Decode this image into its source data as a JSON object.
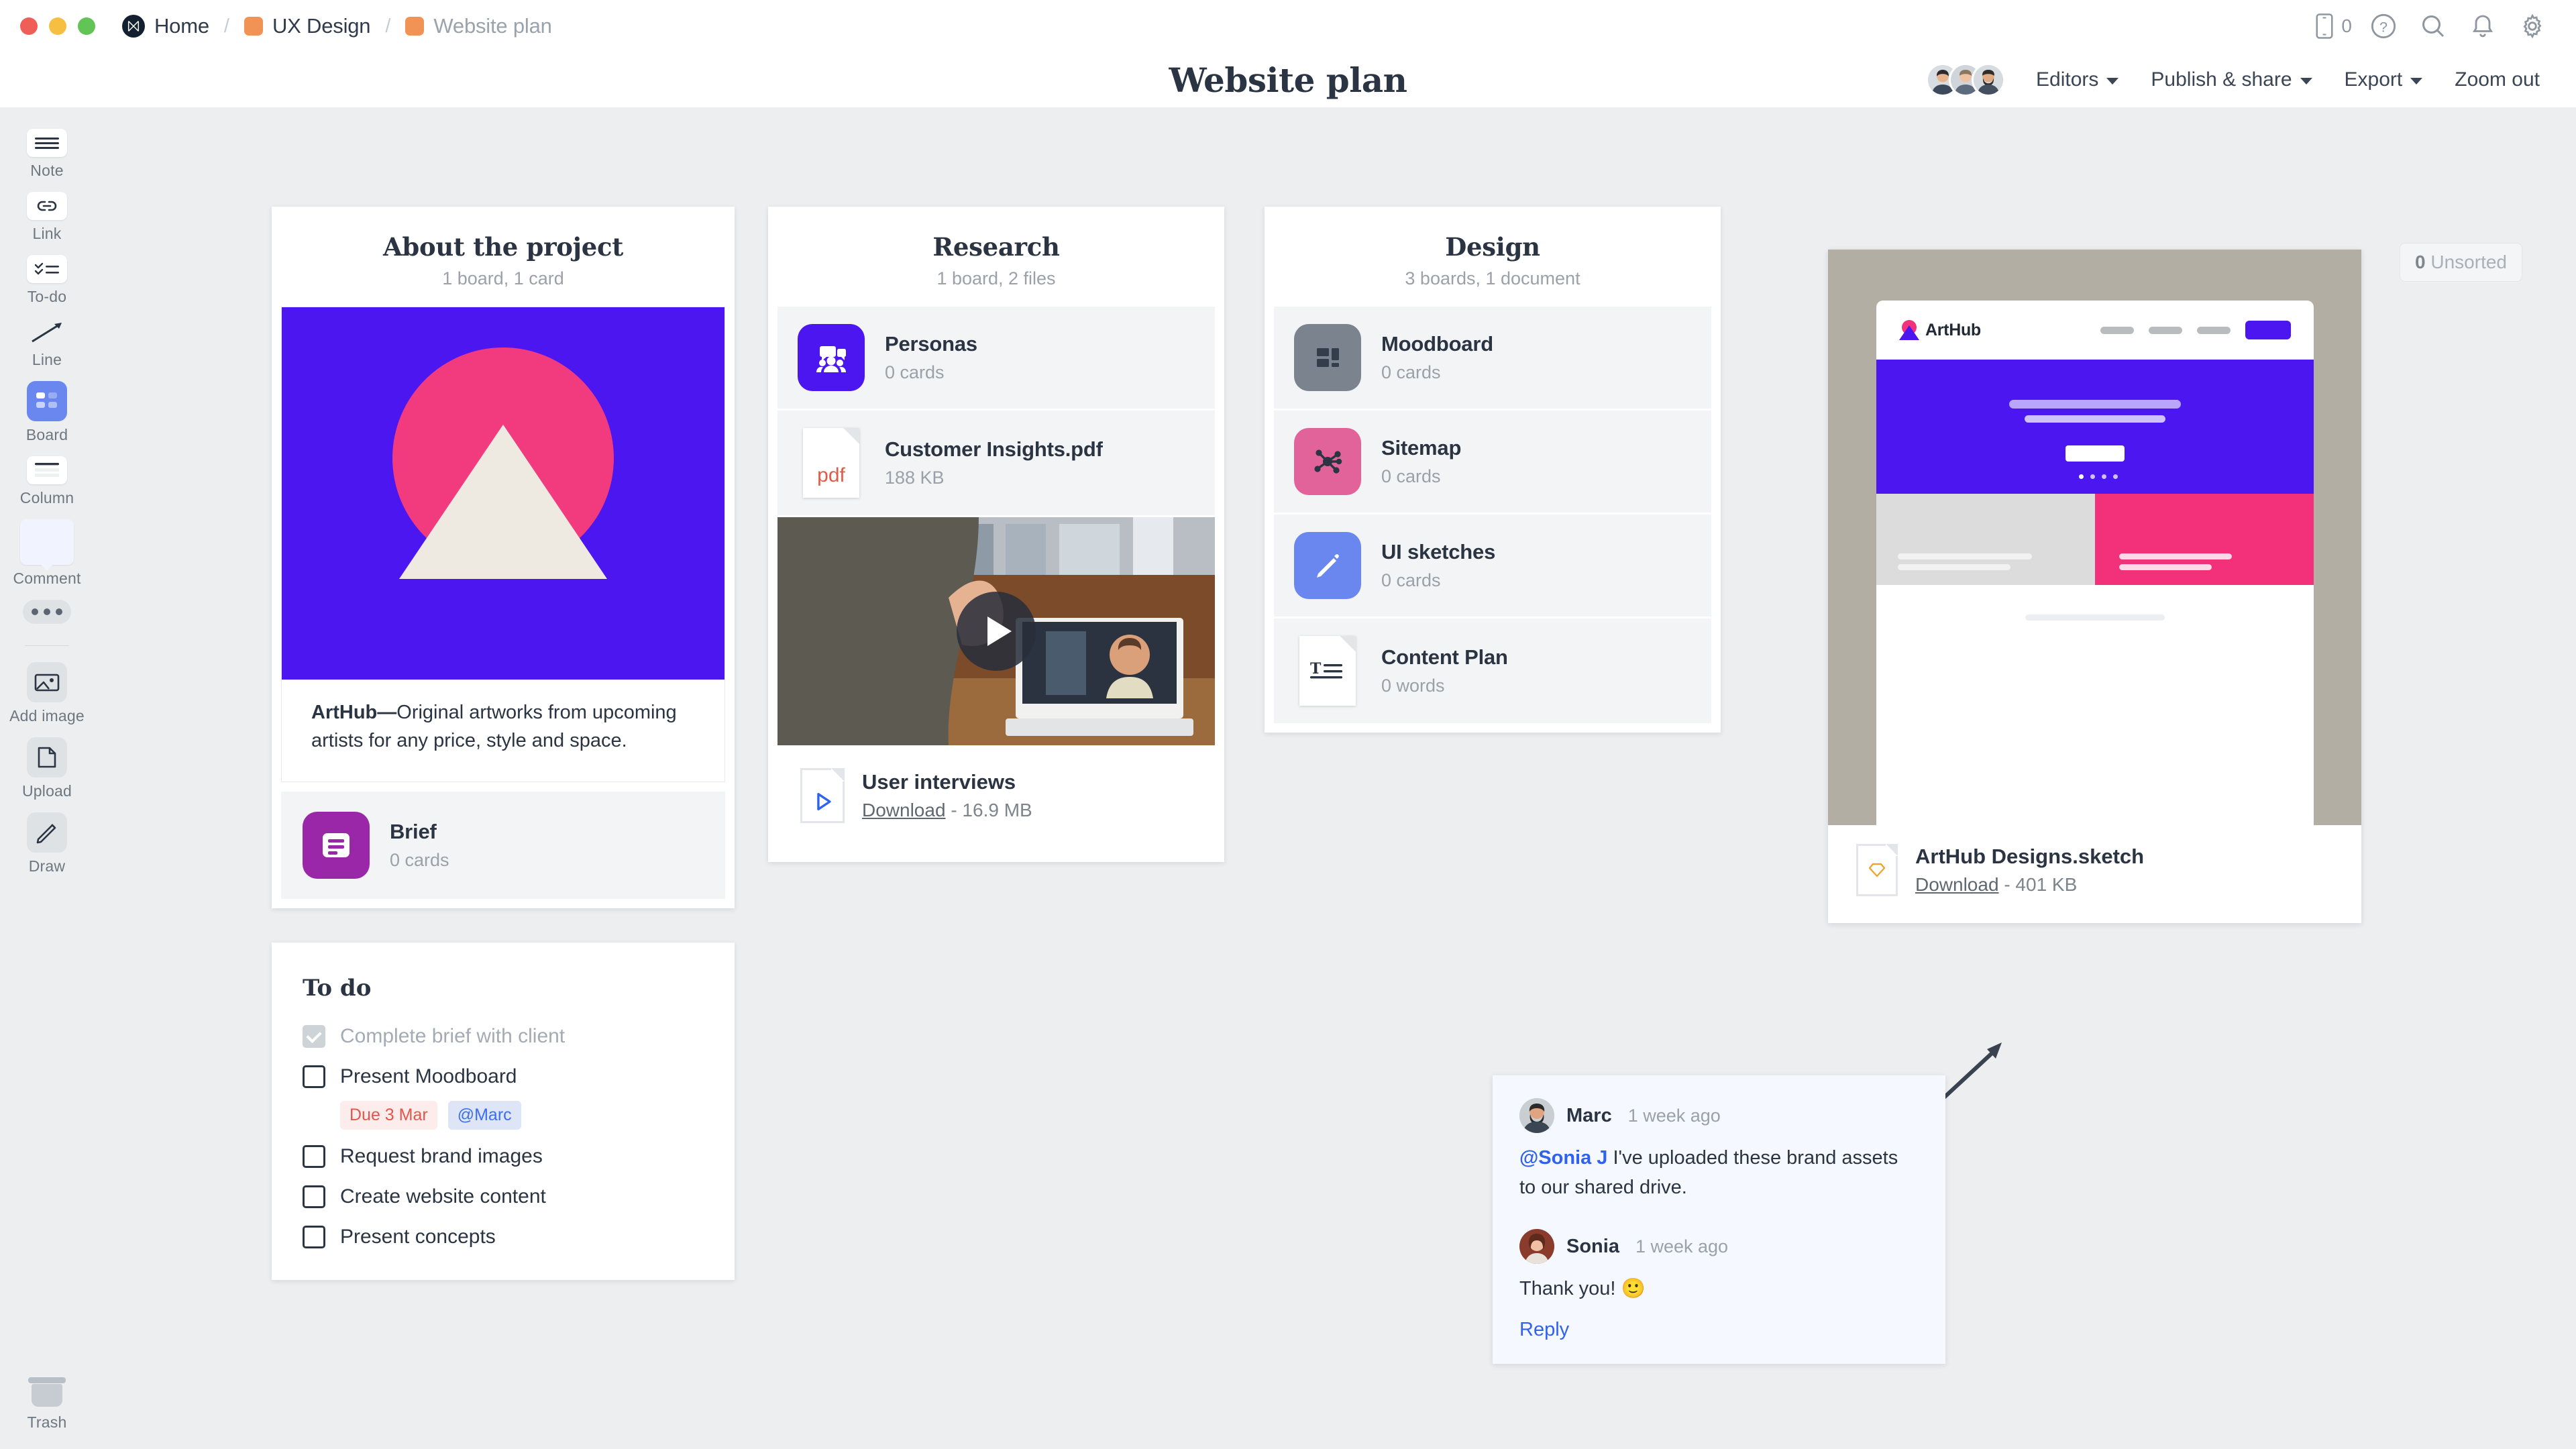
{
  "window": {
    "traffic_lights": [
      "close",
      "minimize",
      "zoom"
    ]
  },
  "breadcrumb": {
    "items": [
      {
        "label": "Home",
        "icon": "milanote-logo-icon",
        "muted": false
      },
      {
        "label": "UX Design",
        "icon": "orange-folder-swatch",
        "muted": false
      },
      {
        "label": "Website plan",
        "icon": "orange-folder-swatch",
        "muted": true
      }
    ],
    "separator": "/"
  },
  "topbar": {
    "device_count": "0",
    "icons": [
      "mobile-preview-icon",
      "help-icon",
      "search-icon",
      "notifications-icon",
      "settings-icon"
    ]
  },
  "header": {
    "title": "Website plan",
    "editors_label": "Editors",
    "publish_label": "Publish & share",
    "export_label": "Export",
    "zoom_out_label": "Zoom out",
    "avatar_count": 3
  },
  "canvas": {
    "unsorted_count": "0",
    "unsorted_label": "Unsorted"
  },
  "sidebar": {
    "tools": [
      {
        "label": "Note",
        "icon": "note-icon"
      },
      {
        "label": "Link",
        "icon": "link-icon"
      },
      {
        "label": "To-do",
        "icon": "todo-icon"
      },
      {
        "label": "Line",
        "icon": "line-arrow-icon"
      },
      {
        "label": "Board",
        "icon": "board-icon",
        "selected": true
      },
      {
        "label": "Column",
        "icon": "column-icon"
      },
      {
        "label": "Comment",
        "icon": "comment-icon"
      },
      {
        "label": "More",
        "icon": "ellipsis-icon"
      },
      {
        "label": "Add image",
        "icon": "image-icon"
      },
      {
        "label": "Upload",
        "icon": "upload-file-icon"
      },
      {
        "label": "Draw",
        "icon": "pencil-icon"
      }
    ],
    "trash_label": "Trash"
  },
  "columns": [
    {
      "title": "About the project",
      "subtitle": "1 board, 1 card",
      "image_caption_bold": "ArtHub—",
      "image_caption": "Original artworks from upcoming artists for any price, style and space.",
      "items": [
        {
          "name": "Brief",
          "meta": "0 cards",
          "icon": "note-board-icon",
          "color": "#9a27a8"
        }
      ]
    },
    {
      "title": "Research",
      "subtitle": "1 board, 2 files",
      "items": [
        {
          "name": "Personas",
          "meta": "0 cards",
          "icon": "personas-icon",
          "color": "#4b16f0"
        },
        {
          "name": "Customer Insights.pdf",
          "meta": "188 KB",
          "icon": "pdf-file-icon",
          "badge": "pdf"
        }
      ],
      "video": {
        "name": "User interviews",
        "download_label": "Download",
        "size": "16.9 MB",
        "separator": "-",
        "icon": "video-file-icon"
      }
    },
    {
      "title": "Design",
      "subtitle": "3 boards, 1 document",
      "items": [
        {
          "name": "Moodboard",
          "meta": "0 cards",
          "icon": "moodboard-icon",
          "color": "#7b838e"
        },
        {
          "name": "Sitemap",
          "meta": "0 cards",
          "icon": "sitemap-icon",
          "color": "#e2629a"
        },
        {
          "name": "UI sketches",
          "meta": "0 cards",
          "icon": "pencil-icon",
          "color": "#6a87ef"
        },
        {
          "name": "Content Plan",
          "meta": "0 words",
          "icon": "document-text-icon"
        }
      ]
    }
  ],
  "todo_card": {
    "title": "To do",
    "items": [
      {
        "label": "Complete brief with client",
        "done": true,
        "tags": []
      },
      {
        "label": "Present Moodboard",
        "done": false,
        "tags": [
          {
            "text": "Due 3 Mar",
            "type": "due"
          },
          {
            "text": "@Marc",
            "type": "person"
          }
        ]
      },
      {
        "label": "Request brand images",
        "done": false,
        "tags": []
      },
      {
        "label": "Create website content",
        "done": false,
        "tags": []
      },
      {
        "label": "Present concepts",
        "done": false,
        "tags": []
      }
    ]
  },
  "sketch_card": {
    "name": "ArtHub Designs.sketch",
    "download_label": "Download",
    "separator": "-",
    "size": "401 KB",
    "icon": "sketch-file-icon",
    "mock_logo_text": "ArtHub"
  },
  "comment_card": {
    "comments": [
      {
        "author": "Marc",
        "time": "1 week ago",
        "mention": "@Sonia J",
        "body": " I've uploaded these brand assets to our shared drive."
      },
      {
        "author": "Sonia",
        "time": "1 week ago",
        "mention": "",
        "body": "Thank you! 🙂"
      }
    ],
    "reply_label": "Reply"
  },
  "colors": {
    "accent_purple": "#4b16f0",
    "accent_pink": "#f2317a",
    "blue_link": "#2f62ef",
    "canvas_bg": "#eceef0",
    "due_red": "#e2574c"
  }
}
